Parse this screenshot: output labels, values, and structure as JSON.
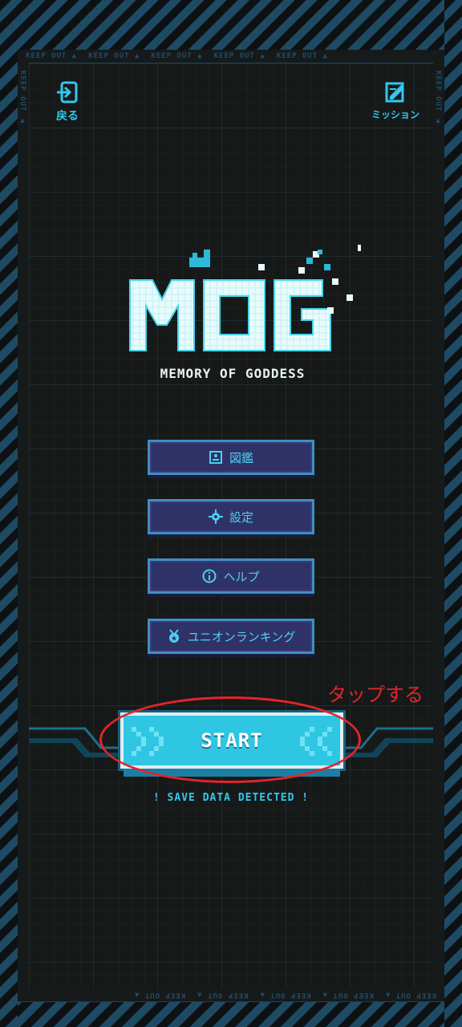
{
  "frame": {
    "tape_text": "KEEP OUT"
  },
  "header": {
    "back": {
      "label": "戻る",
      "icon": "exit-icon"
    },
    "mission": {
      "label": "ミッション",
      "icon": "edit-note-icon"
    }
  },
  "logo": {
    "title": "MOG",
    "subtitle": "MEMORY OF GODDESS"
  },
  "menu": [
    {
      "label": "図鑑",
      "icon": "book-icon"
    },
    {
      "label": "設定",
      "icon": "gear-icon"
    },
    {
      "label": "ヘルプ",
      "icon": "info-icon"
    },
    {
      "label": "ユニオンランキング",
      "icon": "medal-icon"
    }
  ],
  "start": {
    "label": "START",
    "status": "! SAVE DATA DETECTED !"
  },
  "annotation": {
    "text": "タップする",
    "color": "#e3242b"
  },
  "colors": {
    "accent": "#33c7ee",
    "button_bg": "#2f3266",
    "start_bg": "#2fc6e3"
  }
}
